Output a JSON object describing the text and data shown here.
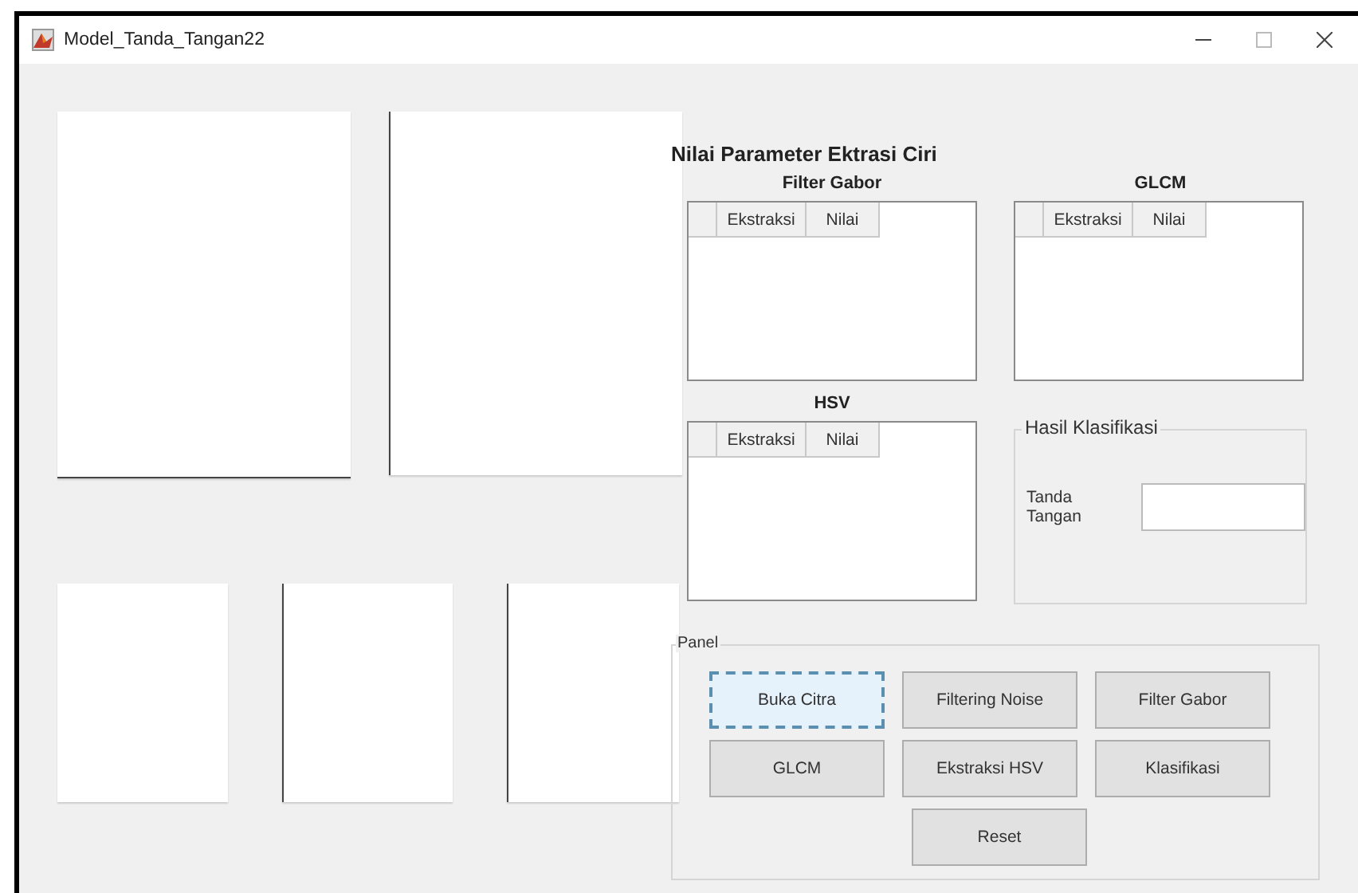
{
  "window": {
    "title": "Model_Tanda_Tangan22"
  },
  "parameters": {
    "title": "Nilai Parameter Ektrasi Ciri",
    "tables": [
      {
        "title": "Filter Gabor",
        "columns": [
          "Ekstraksi",
          "Nilai"
        ]
      },
      {
        "title": "GLCM",
        "columns": [
          "Ekstraksi",
          "Nilai"
        ]
      },
      {
        "title": "HSV",
        "columns": [
          "Ekstraksi",
          "Nilai"
        ]
      }
    ]
  },
  "classification": {
    "title": "Hasil Klasifikasi",
    "label": "Tanda Tangan"
  },
  "panel": {
    "title": "Panel",
    "buttons": [
      {
        "label": "Buka Citra",
        "focused": true
      },
      {
        "label": "Filtering Noise",
        "focused": false
      },
      {
        "label": "Filter Gabor",
        "focused": false
      },
      {
        "label": "GLCM",
        "focused": false
      },
      {
        "label": "Ekstraksi HSV",
        "focused": false
      },
      {
        "label": "Klasifikasi",
        "focused": false
      },
      {
        "label": "Reset",
        "focused": false
      }
    ]
  }
}
